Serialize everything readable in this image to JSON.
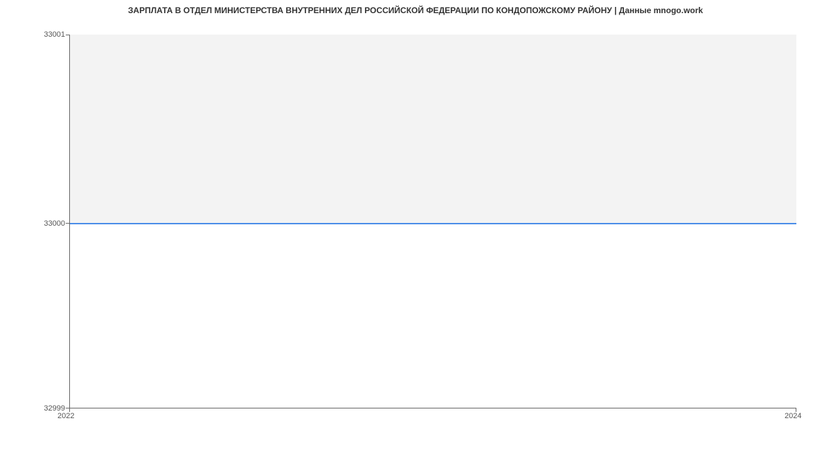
{
  "chart_data": {
    "type": "line",
    "title": "ЗАРПЛАТА В ОТДЕЛ МИНИСТЕРСТВА ВНУТРЕННИХ ДЕЛ РОССИЙСКОЙ ФЕДЕРАЦИИ ПО КОНДОПОЖСКОМУ РАЙОНУ | Данные mnogo.work",
    "x": [
      2022,
      2024
    ],
    "values": [
      33000,
      33000
    ],
    "xlim": [
      2022,
      2024
    ],
    "ylim": [
      32999,
      33001
    ],
    "x_ticks": [
      "2022",
      "2024"
    ],
    "y_ticks": [
      "32999",
      "33000",
      "33001"
    ],
    "xlabel": "",
    "ylabel": ""
  }
}
